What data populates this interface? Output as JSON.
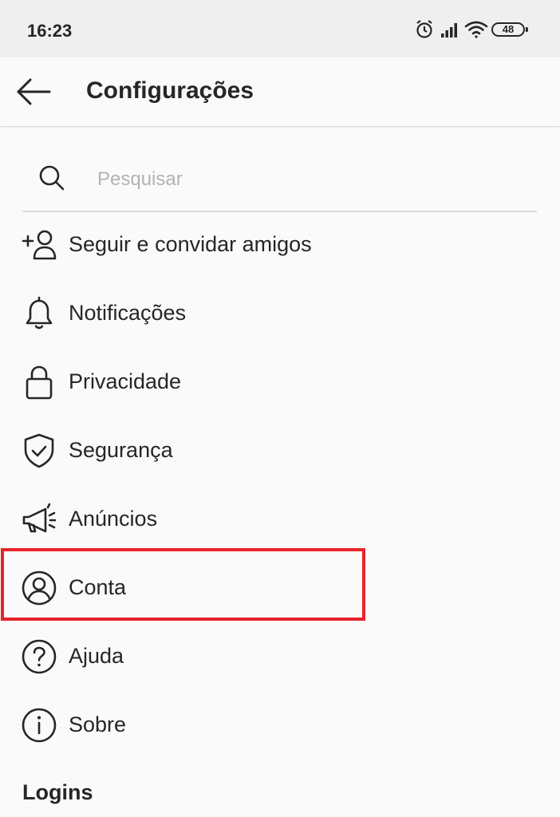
{
  "status_bar": {
    "time": "16:23",
    "battery": "48",
    "icons": [
      "alarm-icon",
      "signal-icon",
      "wifi-icon",
      "battery-icon"
    ]
  },
  "header": {
    "title": "Configurações",
    "back_icon": "arrow-left-icon"
  },
  "search": {
    "placeholder": "Pesquisar",
    "value": ""
  },
  "menu": {
    "items": [
      {
        "label": "Seguir e convidar amigos",
        "icon": "add-person-icon"
      },
      {
        "label": "Notificações",
        "icon": "bell-icon"
      },
      {
        "label": "Privacidade",
        "icon": "lock-icon"
      },
      {
        "label": "Segurança",
        "icon": "shield-icon"
      },
      {
        "label": "Anúncios",
        "icon": "megaphone-icon"
      },
      {
        "label": "Conta",
        "icon": "user-circle-icon"
      },
      {
        "label": "Ajuda",
        "icon": "help-icon"
      },
      {
        "label": "Sobre",
        "icon": "info-icon"
      }
    ]
  },
  "sections": {
    "logins": "Logins"
  },
  "colors": {
    "background": "#fafafa",
    "text": "#262626",
    "highlight": "#e8232b",
    "divider": "#dbdbdb",
    "placeholder": "#b3b3b3"
  }
}
